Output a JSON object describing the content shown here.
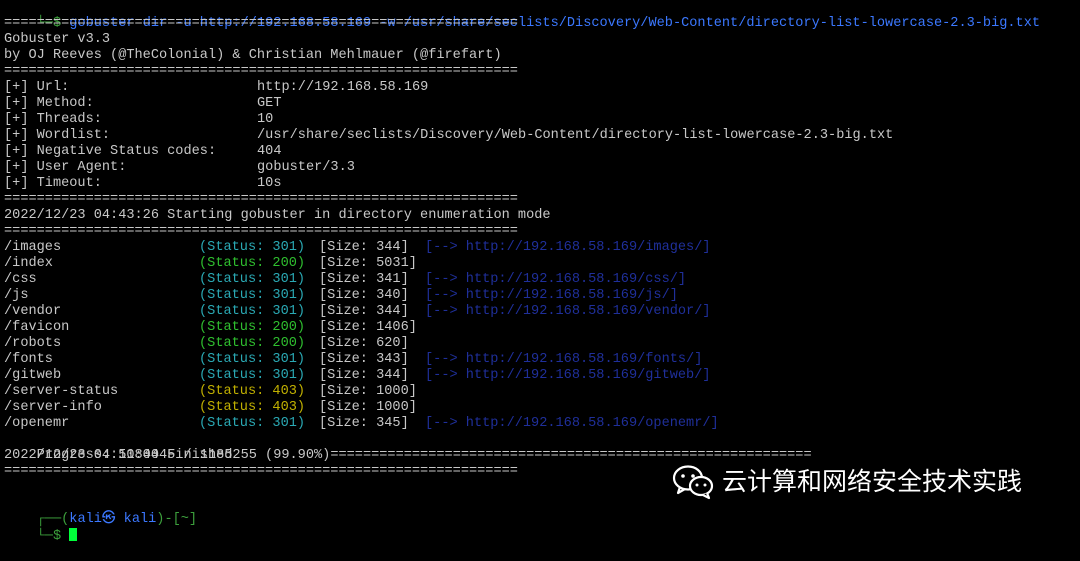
{
  "command": {
    "prefix": "└─$ ",
    "text": "gobuster dir -u http://192.168.58.169 -w /usr/share/seclists/Discovery/Web-Content/directory-list-lowercase-2.3-big.txt"
  },
  "separator": "===============================================================",
  "banner": {
    "version": "Gobuster v3.3",
    "authors": "by OJ Reeves (@TheColonial) & Christian Mehlmauer (@firefart)"
  },
  "config": [
    {
      "key": "[+] Url:",
      "value": "http://192.168.58.169"
    },
    {
      "key": "[+] Method:",
      "value": "GET"
    },
    {
      "key": "[+] Threads:",
      "value": "10"
    },
    {
      "key": "[+] Wordlist:",
      "value": "/usr/share/seclists/Discovery/Web-Content/directory-list-lowercase-2.3-big.txt"
    },
    {
      "key": "[+] Negative Status codes:",
      "value": "404"
    },
    {
      "key": "[+] User Agent:",
      "value": "gobuster/3.3"
    },
    {
      "key": "[+] Timeout:",
      "value": "10s"
    }
  ],
  "start_line": "2022/12/23 04:43:26 Starting gobuster in directory enumeration mode",
  "results": [
    {
      "path": "/images",
      "status": "(Status: 301)",
      "code": "301",
      "size": "[Size: 344]",
      "redirect": "[--> http://192.168.58.169/images/]"
    },
    {
      "path": "/index",
      "status": "(Status: 200)",
      "code": "200",
      "size": "[Size: 5031]",
      "redirect": ""
    },
    {
      "path": "/css",
      "status": "(Status: 301)",
      "code": "301",
      "size": "[Size: 341]",
      "redirect": "[--> http://192.168.58.169/css/]"
    },
    {
      "path": "/js",
      "status": "(Status: 301)",
      "code": "301",
      "size": "[Size: 340]",
      "redirect": "[--> http://192.168.58.169/js/]"
    },
    {
      "path": "/vendor",
      "status": "(Status: 301)",
      "code": "301",
      "size": "[Size: 344]",
      "redirect": "[--> http://192.168.58.169/vendor/]"
    },
    {
      "path": "/favicon",
      "status": "(Status: 200)",
      "code": "200",
      "size": "[Size: 1406]",
      "redirect": ""
    },
    {
      "path": "/robots",
      "status": "(Status: 200)",
      "code": "200",
      "size": "[Size: 620]",
      "redirect": ""
    },
    {
      "path": "/fonts",
      "status": "(Status: 301)",
      "code": "301",
      "size": "[Size: 343]",
      "redirect": "[--> http://192.168.58.169/fonts/]"
    },
    {
      "path": "/gitweb",
      "status": "(Status: 301)",
      "code": "301",
      "size": "[Size: 344]",
      "redirect": "[--> http://192.168.58.169/gitweb/]"
    },
    {
      "path": "/server-status",
      "status": "(Status: 403)",
      "code": "403",
      "size": "[Size: 1000]",
      "redirect": ""
    },
    {
      "path": "/server-info",
      "status": "(Status: 403)",
      "code": "403",
      "size": "[Size: 1000]",
      "redirect": ""
    },
    {
      "path": "/openemr",
      "status": "(Status: 301)",
      "code": "301",
      "size": "[Size: 345]",
      "redirect": "[--> http://192.168.58.169/openemr/]"
    }
  ],
  "progress": {
    "label": "Progress: 1184045 / 1185255 (99.90%)",
    "fraction": 0.999,
    "bar": "==========================================================="
  },
  "finished_line": "2022/12/23 04:50:04 Finished",
  "prompt": {
    "top_left": "┌──(",
    "user_host": "kali㉿ kali",
    "dir_part": ")-[~]",
    "bottom_left": "└─$ "
  },
  "watermark": {
    "text": "云计算和网络安全技术实践",
    "icon": "wechat-icon"
  },
  "colors": {
    "status_200": "#2fbf2f",
    "status_301": "#2aa9b4",
    "status_403": "#c0b000",
    "redirect": "#1f2f9a",
    "command": "#3b78ff",
    "cursor": "#00ff3a"
  }
}
